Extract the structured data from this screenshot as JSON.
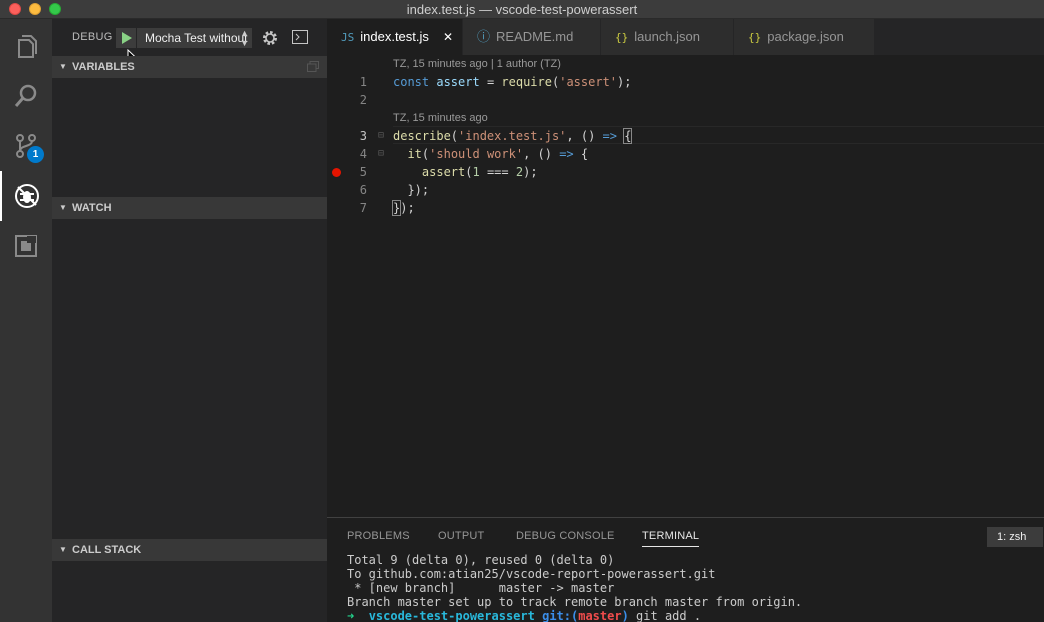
{
  "window": {
    "title": "index.test.js — vscode-test-powerassert"
  },
  "activity": {
    "scm_badge": "1"
  },
  "debug": {
    "label": "DEBUG",
    "config": "Mocha Test without",
    "sections": {
      "variables": "VARIABLES",
      "watch": "WATCH",
      "call_stack": "CALL STACK"
    }
  },
  "tabs": [
    {
      "icon": "JS",
      "label": "index.test.js"
    },
    {
      "icon": "ⓘ",
      "label": "README.md"
    },
    {
      "icon": "{}",
      "label": "launch.json"
    },
    {
      "icon": "{}",
      "label": "package.json"
    }
  ],
  "editor": {
    "codelens_1": "TZ, 15 minutes ago | 1 author (TZ)",
    "codelens_2": "TZ, 15 minutes ago",
    "line_numbers": [
      "1",
      "2",
      "3",
      "4",
      "5",
      "6",
      "7"
    ],
    "lines": [
      "const assert = require('assert');",
      "",
      "describe('index.test.js', () => {",
      "  it('should work', () => {",
      "    assert(1 === 2);",
      "  });",
      "});"
    ]
  },
  "panel": {
    "tabs": [
      "PROBLEMS",
      "OUTPUT",
      "DEBUG CONSOLE",
      "TERMINAL"
    ],
    "terminal_select": "1: zsh",
    "terminal_lines": [
      "Total 9 (delta 0), reused 0 (delta 0)",
      "To github.com:atian25/vscode-report-powerassert.git",
      " * [new branch]      master -> master",
      "Branch master set up to track remote branch master from origin."
    ],
    "prompt": {
      "arrow": "➜",
      "dir": "vscode-test-powerassert",
      "git": "git:(",
      "branch": "master",
      "git_close": ")",
      "command": "git add ."
    }
  }
}
